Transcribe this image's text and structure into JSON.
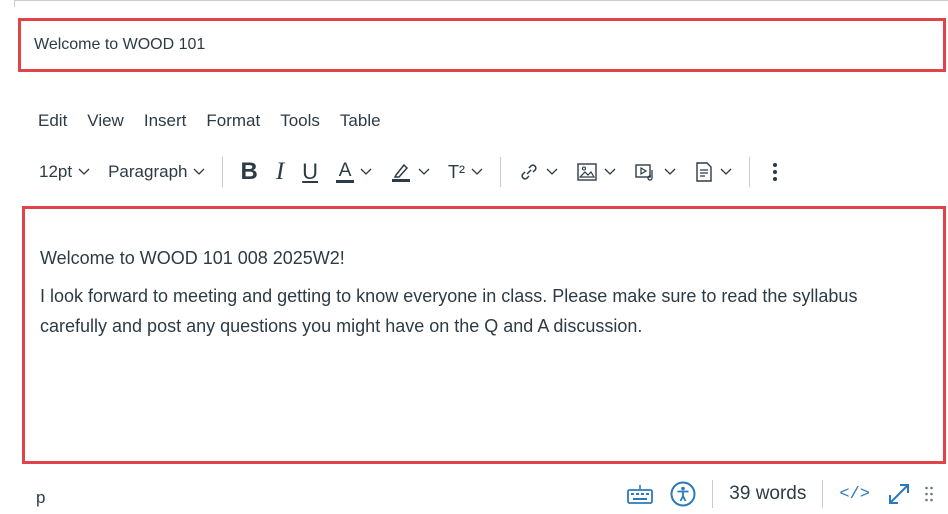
{
  "title": {
    "value": "Welcome to WOOD 101"
  },
  "menubar": {
    "items": [
      "Edit",
      "View",
      "Insert",
      "Format",
      "Tools",
      "Table"
    ]
  },
  "toolbar": {
    "font_size": "12pt",
    "block_format": "Paragraph",
    "bold": "B",
    "italic": "I",
    "underline": "U",
    "text_color": "A",
    "superscript": "T²"
  },
  "body": {
    "heading": "Welcome to WOOD 101 008 2025W2!",
    "paragraph": "I look forward to meeting and getting to know everyone in class. Please make sure to read the syllabus carefully and post any questions you might have on the Q and A discussion."
  },
  "statusbar": {
    "path": "p",
    "word_count": "39 words",
    "html_toggle": "</>"
  },
  "colors": {
    "highlight": "#e0434a",
    "accent": "#2b7abc",
    "text": "#2d3b45"
  }
}
